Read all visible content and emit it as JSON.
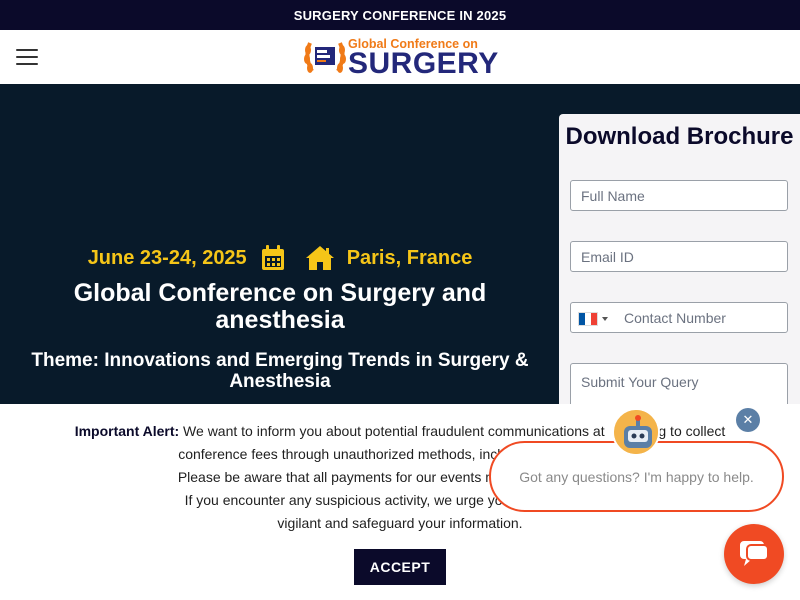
{
  "topbar": {
    "text": "SURGERY CONFERENCE IN 2025"
  },
  "header": {
    "logo_line1": "Global Conference on",
    "logo_line2": "SURGERY"
  },
  "hero": {
    "date": "June 23-24, 2025",
    "location": "Paris, France",
    "title": "Global Conference on Surgery and anesthesia",
    "theme": "Theme: Innovations and Emerging Trends in Surgery & Anesthesia"
  },
  "form": {
    "title": "Download Brochure",
    "name_placeholder": "Full Name",
    "email_placeholder": "Email ID",
    "phone_placeholder": "Contact Number",
    "query_placeholder": "Submit Your Query"
  },
  "alert": {
    "label": "Important Alert:",
    "line1_a": " We want to inform you about potential fraudulent communications at",
    "line1_b": "ng to collect",
    "line2": "conference fees through unauthorized methods, including the use of clo",
    "line3": "Please be aware that all payments for our events must be processed ex",
    "line4": "If you encounter any suspicious activity, we urge you to report it imme",
    "line5": "vigilant and safeguard your information.",
    "accept_label": "ACCEPT"
  },
  "chat": {
    "message": "Got any questions? I'm happy to help.",
    "close_symbol": "✕"
  },
  "colors": {
    "navy": "#0b0a2a",
    "hero_bg": "#081a2a",
    "accent_yellow": "#f5c518",
    "chat_orange": "#f04a23",
    "logo_orange": "#f07a17",
    "logo_blue": "#23287a"
  },
  "icons": {
    "menu": "hamburger-menu-icon",
    "calendar": "calendar-icon",
    "home": "home-icon",
    "flag": "france-flag-icon",
    "chat": "chat-bubble-icon"
  }
}
